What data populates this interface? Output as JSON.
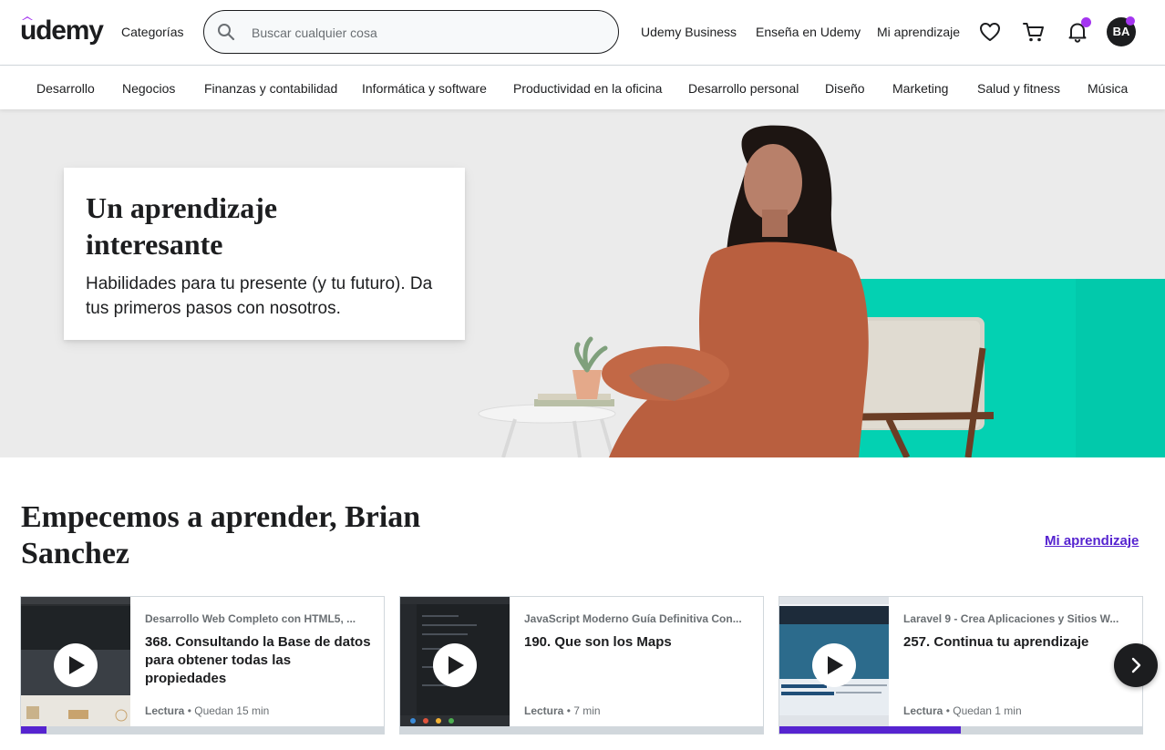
{
  "header": {
    "logo": "udemy",
    "categories": "Categorías",
    "search_placeholder": "Buscar cualquier cosa",
    "links": [
      "Udemy Business",
      "Enseña en Udemy",
      "Mi aprendizaje"
    ],
    "avatar_initials": "BA",
    "accent_color": "#a435f0"
  },
  "category_bar": [
    "Desarrollo",
    "Negocios",
    "Finanzas y contabilidad",
    "Informática y software",
    "Productividad en la oficina",
    "Desarrollo personal",
    "Diseño",
    "Marketing",
    "Salud y fitness",
    "Música"
  ],
  "hero": {
    "title": "Un aprendizaje interesante",
    "subtitle": "Habilidades para tu presente (y tu futuro). Da tus primeros pasos con nosotros."
  },
  "learning": {
    "greeting": "Empecemos a aprender, Brian Sanchez",
    "my_learning_link": "Mi aprendizaje",
    "cards": [
      {
        "course": "Desarrollo Web Completo con HTML5, ...",
        "lecture": "368. Consultando la Base de datos para obtener todas las propiedades",
        "type": "Lectura",
        "remaining": "Quedan 15 min",
        "progress": 0.07
      },
      {
        "course": "JavaScript Moderno Guía Definitiva Con...",
        "lecture": "190. Que son los Maps",
        "type": "Lectura",
        "remaining": "7 min",
        "progress": 0.0
      },
      {
        "course": "Laravel 9 - Crea Aplicaciones y Sitios W...",
        "lecture": "257. Continua tu aprendizaje",
        "type": "Lectura",
        "remaining": "Quedan 1 min",
        "progress": 0.5
      }
    ]
  }
}
